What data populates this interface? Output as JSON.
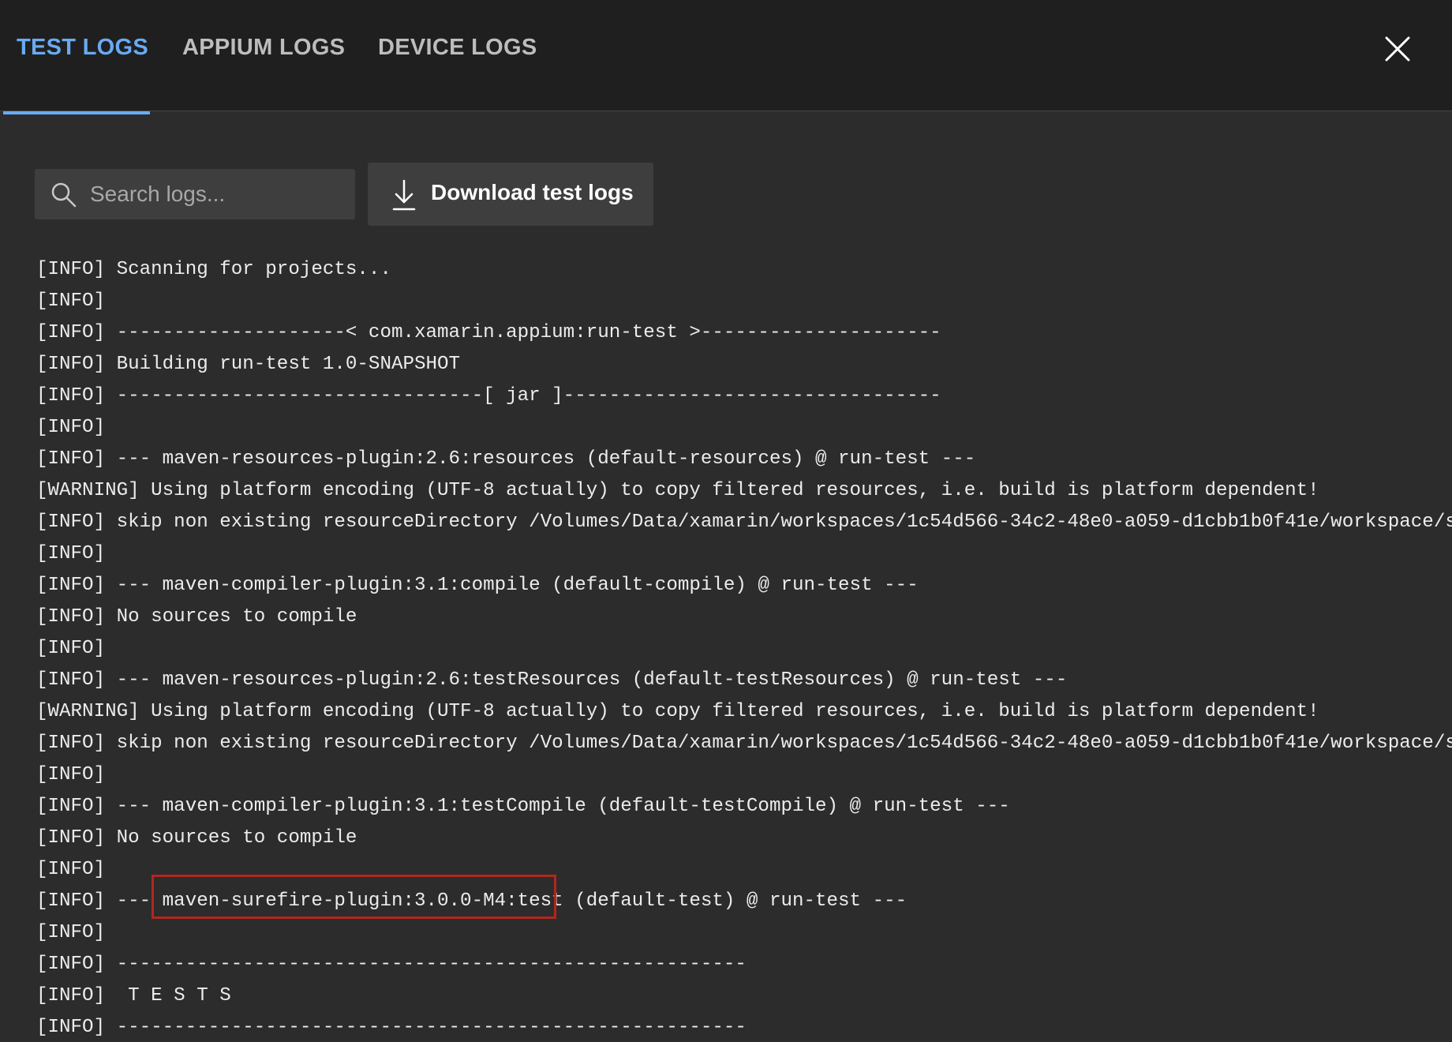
{
  "tabs": [
    {
      "label": "TEST LOGS",
      "active": true
    },
    {
      "label": "APPIUM LOGS",
      "active": false
    },
    {
      "label": "DEVICE LOGS",
      "active": false
    }
  ],
  "icons": {
    "close": "close-icon",
    "search": "search-icon",
    "download": "download-icon"
  },
  "search": {
    "placeholder": "Search logs...",
    "value": ""
  },
  "download_button": {
    "label": "Download test logs"
  },
  "colors": {
    "background": "#2c2c2c",
    "header_background": "#1f1f1f",
    "active_tab": "#6aaaf2",
    "inactive_tab": "#bdbdbd",
    "highlight_border": "#b0271d"
  },
  "highlight": {
    "line_index": 20,
    "text": "maven-surefire-plugin:3.0.0-M4:test"
  },
  "log_lines": [
    "[INFO] Scanning for projects...",
    "[INFO]",
    "[INFO] --------------------< com.xamarin.appium:run-test >---------------------",
    "[INFO] Building run-test 1.0-SNAPSHOT",
    "[INFO] --------------------------------[ jar ]---------------------------------",
    "[INFO]",
    "[INFO] --- maven-resources-plugin:2.6:resources (default-resources) @ run-test ---",
    "[WARNING] Using platform encoding (UTF-8 actually) to copy filtered resources, i.e. build is platform dependent!",
    "[INFO] skip non existing resourceDirectory /Volumes/Data/xamarin/workspaces/1c54d566-34c2-48e0-a059-d1cbb1b0f41e/workspace/s",
    "[INFO]",
    "[INFO] --- maven-compiler-plugin:3.1:compile (default-compile) @ run-test ---",
    "[INFO] No sources to compile",
    "[INFO]",
    "[INFO] --- maven-resources-plugin:2.6:testResources (default-testResources) @ run-test ---",
    "[WARNING] Using platform encoding (UTF-8 actually) to copy filtered resources, i.e. build is platform dependent!",
    "[INFO] skip non existing resourceDirectory /Volumes/Data/xamarin/workspaces/1c54d566-34c2-48e0-a059-d1cbb1b0f41e/workspace/s",
    "[INFO]",
    "[INFO] --- maven-compiler-plugin:3.1:testCompile (default-testCompile) @ run-test ---",
    "[INFO] No sources to compile",
    "[INFO]",
    "[INFO] --- maven-surefire-plugin:3.0.0-M4:test (default-test) @ run-test ---",
    "[INFO]",
    "[INFO] -------------------------------------------------------",
    "[INFO]  T E S T S",
    "[INFO] -------------------------------------------------------"
  ]
}
